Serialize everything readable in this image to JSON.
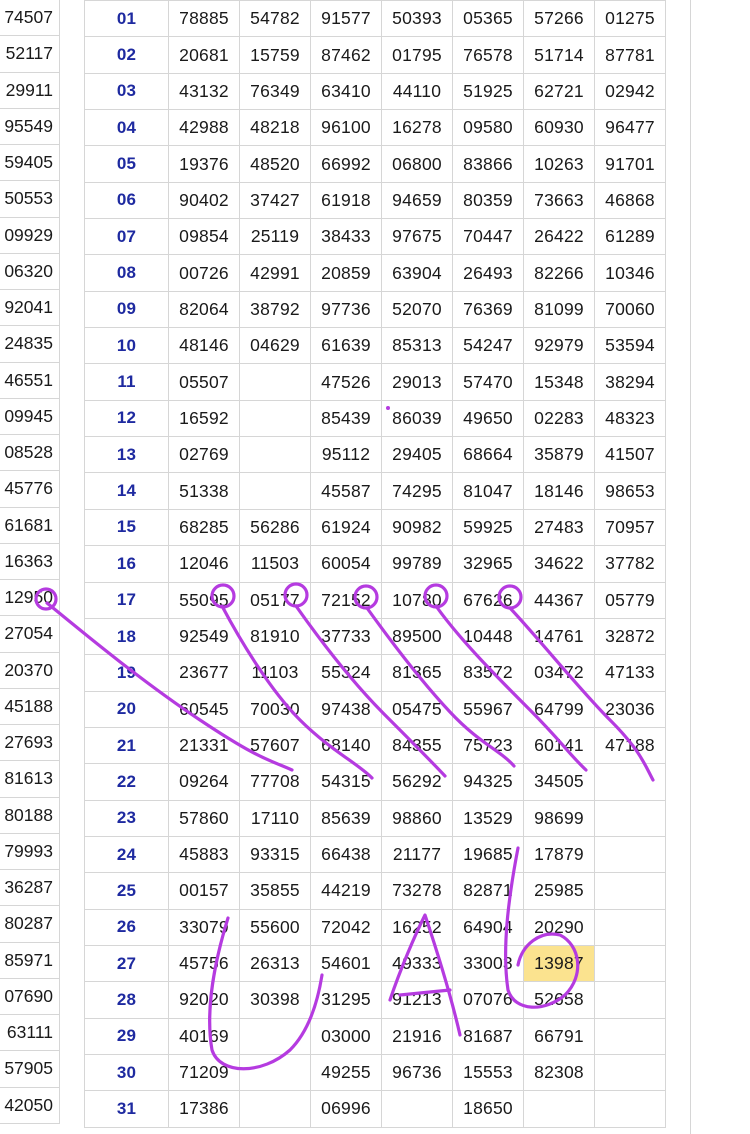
{
  "left_column": [
    "74507",
    "52117",
    "29911",
    "95549",
    "59405",
    "50553",
    "09929",
    "06320",
    "92041",
    "24835",
    "46551",
    "09945",
    "08528",
    "45776",
    "61681",
    "16363",
    "12950",
    "27054",
    "20370",
    "45188",
    "27693",
    "81613",
    "80188",
    "79993",
    "36287",
    "80287",
    "85971",
    "07690",
    "63111",
    "57905",
    "42050"
  ],
  "rows": [
    {
      "day": "01",
      "values": [
        "78885",
        "54782",
        "91577",
        "50393",
        "05365",
        "57266",
        "01275"
      ]
    },
    {
      "day": "02",
      "values": [
        "20681",
        "15759",
        "87462",
        "01795",
        "76578",
        "51714",
        "87781"
      ]
    },
    {
      "day": "03",
      "values": [
        "43132",
        "76349",
        "63410",
        "44110",
        "51925",
        "62721",
        "02942"
      ]
    },
    {
      "day": "04",
      "values": [
        "42988",
        "48218",
        "96100",
        "16278",
        "09580",
        "60930",
        "96477"
      ]
    },
    {
      "day": "05",
      "values": [
        "19376",
        "48520",
        "66992",
        "06800",
        "83866",
        "10263",
        "91701"
      ]
    },
    {
      "day": "06",
      "values": [
        "90402",
        "37427",
        "61918",
        "94659",
        "80359",
        "73663",
        "46868"
      ]
    },
    {
      "day": "07",
      "values": [
        "09854",
        "25119",
        "38433",
        "97675",
        "70447",
        "26422",
        "61289"
      ]
    },
    {
      "day": "08",
      "values": [
        "00726",
        "42991",
        "20859",
        "63904",
        "26493",
        "82266",
        "10346"
      ]
    },
    {
      "day": "09",
      "values": [
        "82064",
        "38792",
        "97736",
        "52070",
        "76369",
        "81099",
        "70060"
      ]
    },
    {
      "day": "10",
      "values": [
        "48146",
        "04629",
        "61639",
        "85313",
        "54247",
        "92979",
        "53594"
      ]
    },
    {
      "day": "11",
      "values": [
        "05507",
        "",
        "47526",
        "29013",
        "57470",
        "15348",
        "38294"
      ]
    },
    {
      "day": "12",
      "values": [
        "16592",
        "",
        "85439",
        "86039",
        "49650",
        "02283",
        "48323"
      ]
    },
    {
      "day": "13",
      "values": [
        "02769",
        "",
        "95112",
        "29405",
        "68664",
        "35879",
        "41507"
      ]
    },
    {
      "day": "14",
      "values": [
        "51338",
        "",
        "45587",
        "74295",
        "81047",
        "18146",
        "98653"
      ]
    },
    {
      "day": "15",
      "values": [
        "68285",
        "56286",
        "61924",
        "90982",
        "59925",
        "27483",
        "70957"
      ]
    },
    {
      "day": "16",
      "values": [
        "12046",
        "11503",
        "60054",
        "99789",
        "32965",
        "34622",
        "37782"
      ]
    },
    {
      "day": "17",
      "values": [
        "55095",
        "05177",
        "72152",
        "10780",
        "67626",
        "44367",
        "05779"
      ]
    },
    {
      "day": "18",
      "values": [
        "92549",
        "81910",
        "37733",
        "89500",
        "10448",
        "14761",
        "32872"
      ]
    },
    {
      "day": "19",
      "values": [
        "23677",
        "11103",
        "55324",
        "81365",
        "83572",
        "03472",
        "47133"
      ]
    },
    {
      "day": "20",
      "values": [
        "60545",
        "70030",
        "97438",
        "05475",
        "55967",
        "64799",
        "23036"
      ]
    },
    {
      "day": "21",
      "values": [
        "21331",
        "57607",
        "68140",
        "84355",
        "75723",
        "60141",
        "47188"
      ]
    },
    {
      "day": "22",
      "values": [
        "09264",
        "77708",
        "54315",
        "56292",
        "94325",
        "34505",
        ""
      ]
    },
    {
      "day": "23",
      "values": [
        "57860",
        "17110",
        "85639",
        "98860",
        "13529",
        "98699",
        ""
      ]
    },
    {
      "day": "24",
      "values": [
        "45883",
        "93315",
        "66438",
        "21177",
        "19685",
        "17879",
        ""
      ]
    },
    {
      "day": "25",
      "values": [
        "00157",
        "35855",
        "44219",
        "73278",
        "82871",
        "25985",
        ""
      ]
    },
    {
      "day": "26",
      "values": [
        "33079",
        "55600",
        "72042",
        "16252",
        "64904",
        "20290",
        ""
      ]
    },
    {
      "day": "27",
      "values": [
        "45756",
        "26313",
        "54601",
        "49333",
        "33003",
        "13987",
        ""
      ]
    },
    {
      "day": "28",
      "values": [
        "92020",
        "30398",
        "31295",
        "91213",
        "07076",
        "52658",
        ""
      ]
    },
    {
      "day": "29",
      "values": [
        "40169",
        "",
        "03000",
        "21916",
        "81687",
        "66791",
        ""
      ]
    },
    {
      "day": "30",
      "values": [
        "71209",
        "",
        "49255",
        "96736",
        "15553",
        "82308",
        ""
      ]
    },
    {
      "day": "31",
      "values": [
        "17386",
        "",
        "06996",
        "",
        "18650",
        "",
        ""
      ]
    }
  ],
  "highlight": {
    "day": "27",
    "column": 6,
    "color": "#fbe38f"
  },
  "colors": {
    "day_text": "#1e2aa0",
    "gridline": "#d6d6d6",
    "ink": "#b53be0"
  }
}
